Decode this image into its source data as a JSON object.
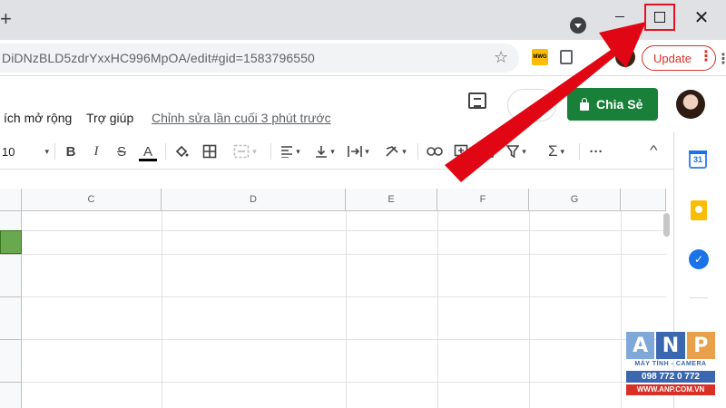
{
  "browser": {
    "new_tab_glyph": "+",
    "close_glyph": "✕",
    "url": "DiDNzBLD5zdrYxxHC996MpOA/edit#gid=1583796550",
    "star_glyph": "☆",
    "ext1_label": "MWG",
    "update_label": "Update",
    "menu_glyph": "⋮",
    "icons": [
      "tab-search-icon",
      "minimize-icon",
      "maximize-icon",
      "close-icon",
      "star-icon",
      "extension-icon",
      "profile-avatar",
      "kebab-icon"
    ],
    "highlight_color": "#e81123"
  },
  "docs": {
    "menu_items": [
      "ích mở rộng",
      "Trợ giúp"
    ],
    "last_edit": "Chỉnh sửa lần cuối 3 phút trước",
    "share_label": "Chia Sẻ",
    "share_color": "#188038"
  },
  "toolbar": {
    "font_size": "10",
    "caret": "▾",
    "bold": "B",
    "italic": "I",
    "strike": "S",
    "text_color": "A",
    "sigma": "Σ",
    "more": "···",
    "collapse": "^"
  },
  "grid": {
    "columns": [
      "C",
      "D",
      "E",
      "F",
      "G"
    ],
    "selected_cell_color": "#6aa84f"
  },
  "sidepanel": {
    "calendar_day": "31",
    "tasks_glyph": "✓"
  },
  "watermark": {
    "letters": [
      "A",
      "N",
      "P"
    ],
    "subtitle": "MÁY TÍNH - CAMERA",
    "phone": "098 772 0 772",
    "website": "WWW.ANP.COM.VN"
  }
}
